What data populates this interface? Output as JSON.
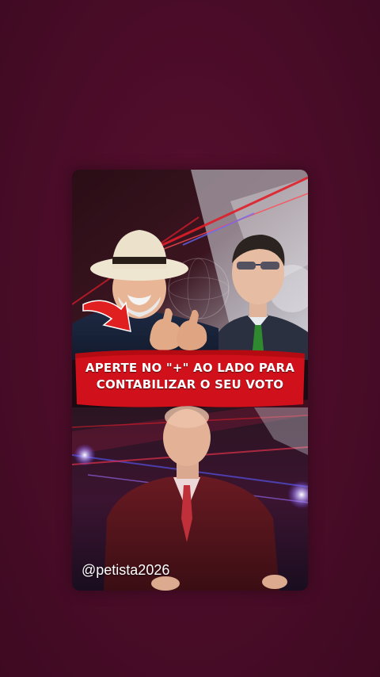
{
  "post": {
    "banner_line1": "APERTE NO \"+\" AO LADO PARA",
    "banner_line2": "CONTABILIZAR O SEU VOTO",
    "watermark": "@petista2026"
  },
  "colors": {
    "page_background": "#4a0c28",
    "banner_red": "#d0101a",
    "accent_red": "#e01e2a",
    "arrow_red": "#e02020"
  },
  "icons": {
    "arrow": "curved-arrow-icon"
  }
}
